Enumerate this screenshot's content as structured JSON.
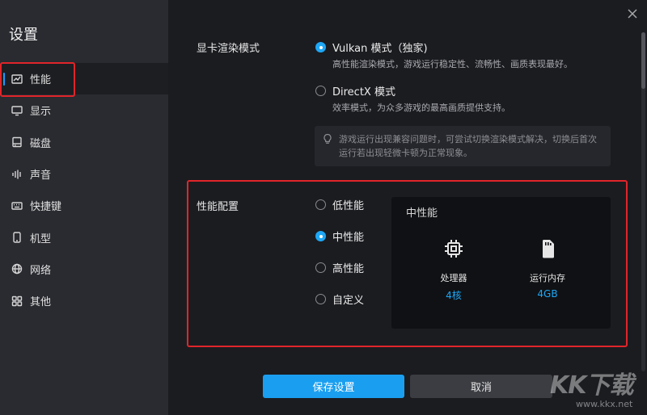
{
  "sidebar": {
    "title": "设置",
    "items": [
      {
        "label": "性能",
        "icon": "chart-icon",
        "active": true
      },
      {
        "label": "显示",
        "icon": "monitor-icon"
      },
      {
        "label": "磁盘",
        "icon": "disk-icon"
      },
      {
        "label": "声音",
        "icon": "sound-wave-icon"
      },
      {
        "label": "快捷键",
        "icon": "keyboard-icon"
      },
      {
        "label": "机型",
        "icon": "phone-icon"
      },
      {
        "label": "网络",
        "icon": "globe-icon"
      },
      {
        "label": "其他",
        "icon": "grid-icon"
      }
    ]
  },
  "render": {
    "label": "显卡渲染模式",
    "options": [
      {
        "label": "Vulkan 模式（独家)",
        "desc": "高性能渲染模式，游戏运行稳定性、流畅性、画质表现最好。",
        "checked": true
      },
      {
        "label": "DirectX 模式",
        "desc": "效率模式，为众多游戏的最高画质提供支持。",
        "checked": false
      }
    ],
    "tip": "游戏运行出现兼容问题时，可尝试切换渲染模式解决，切换后首次运行若出现轻微卡顿为正常现象。"
  },
  "performance": {
    "label": "性能配置",
    "options": [
      {
        "label": "低性能",
        "checked": false
      },
      {
        "label": "中性能",
        "checked": true
      },
      {
        "label": "高性能",
        "checked": false
      },
      {
        "label": "自定义",
        "checked": false
      }
    ],
    "card": {
      "title": "中性能",
      "cpu_label": "处理器",
      "cpu_value": "4核",
      "ram_label": "运行内存",
      "ram_value": "4GB"
    }
  },
  "buttons": {
    "save": "保存设置",
    "cancel": "取消"
  },
  "watermark": {
    "brand": "KK下载",
    "url": "www.kkx.net"
  },
  "colors": {
    "accent": "#1ea7f5",
    "highlight": "#e0252a",
    "sidebar_bg": "#2a2b30",
    "main_bg": "#1b1c20"
  }
}
